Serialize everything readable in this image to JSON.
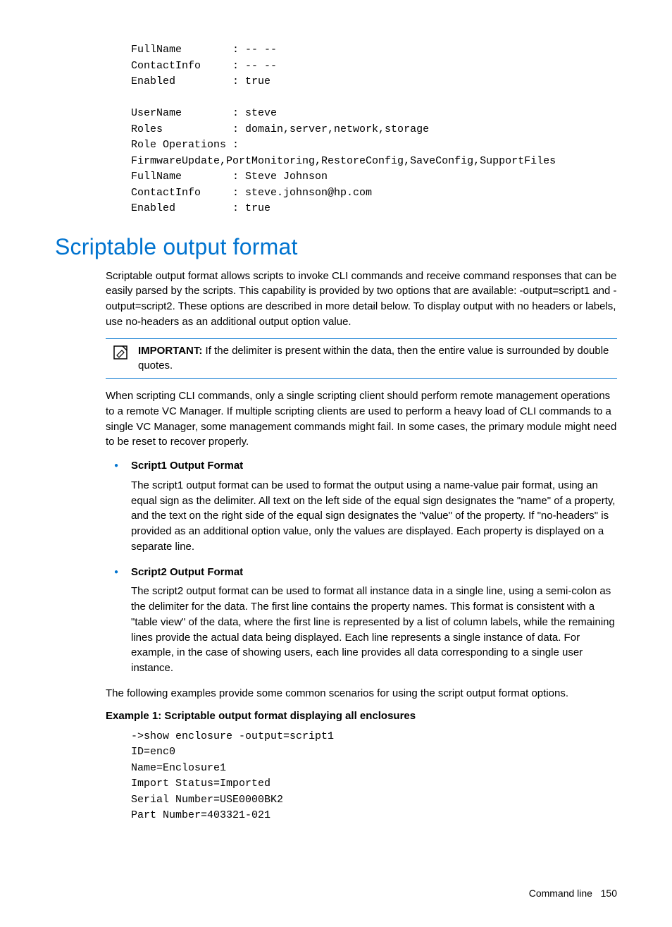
{
  "code_block_top": "FullName        : -- --\nContactInfo     : -- --\nEnabled         : true\n\nUserName        : steve\nRoles           : domain,server,network,storage\nRole Operations :\nFirmwareUpdate,PortMonitoring,RestoreConfig,SaveConfig,SupportFiles\nFullName        : Steve Johnson\nContactInfo     : steve.johnson@hp.com\nEnabled         : true",
  "heading": "Scriptable output format",
  "intro_paragraph": "Scriptable output format allows scripts to invoke CLI commands and receive command responses that can be easily parsed by the scripts. This capability is provided by two options that are available: -output=script1 and -output=script2. These options are described in more detail below. To display output with no headers or labels, use no-headers as an additional output option value.",
  "callout": {
    "label": "IMPORTANT:",
    "text": "  If the delimiter is present within the data, then the entire value is surrounded by double quotes."
  },
  "middle_paragraph": "When scripting CLI commands, only a single scripting client should perform remote management operations to a remote VC Manager. If multiple scripting clients are used to perform a heavy load of CLI commands to a single VC Manager, some management commands might fail. In some cases, the primary module might need to be reset to recover properly.",
  "formats": [
    {
      "title": "Script1 Output Format",
      "body": "The script1 output format can be used to format the output using a name-value pair format, using an equal sign as the delimiter. All text on the left side of the equal sign designates the \"name\" of a property, and the text on the right side of the equal sign designates the \"value\" of the property. If \"no-headers\" is provided as an additional option value, only the values are displayed. Each property is displayed on a separate line."
    },
    {
      "title": "Script2 Output Format",
      "body": "The script2 output format can be used to format all instance data in a single line, using a semi-colon as the delimiter for the data. The first line contains the property names. This format is consistent with a \"table view\" of the data, where the first line is represented by a list of column labels, while the remaining lines provide the actual data being displayed. Each line represents a single instance of data. For example, in the case of showing users, each line provides all data corresponding to a single user instance."
    }
  ],
  "examples_intro": "The following examples provide some common scenarios for using the script output format options.",
  "example1": {
    "title": "Example 1: Scriptable output format displaying all enclosures",
    "code": "->show enclosure -output=script1\nID=enc0\nName=Enclosure1\nImport Status=Imported\nSerial Number=USE0000BK2\nPart Number=403321-021"
  },
  "footer": {
    "section": "Command line",
    "page": "150"
  }
}
